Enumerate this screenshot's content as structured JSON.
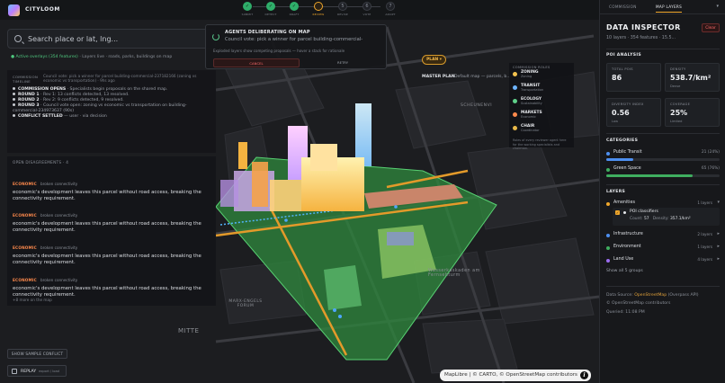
{
  "app": {
    "name": "CITYLOOM"
  },
  "steps": [
    {
      "num": "✓",
      "label": "SUBMIT",
      "state": "done"
    },
    {
      "num": "✓",
      "label": "DETECT",
      "state": "done"
    },
    {
      "num": "✓",
      "label": "DRAFT",
      "state": "done"
    },
    {
      "num": "",
      "label": "REVIEW",
      "state": "active"
    },
    {
      "num": "5",
      "label": "REVISE",
      "state": "todo"
    },
    {
      "num": "6",
      "label": "VOTE",
      "state": "todo"
    },
    {
      "num": "7",
      "label": "ADOPT",
      "state": "todo"
    }
  ],
  "search": {
    "placeholder": "Search place or lat, lng..."
  },
  "layer_hint": {
    "status": "● Active overlays (354 features)",
    "text": "· Layers live · roads, parks, buildings on map"
  },
  "timeline": {
    "title": "COMMISSION TIMELINE",
    "entries": [
      {
        "head": "",
        "body": "Council vote: pick a winner for parcel building-commercial-237182166 (zoning vs economic vs transportation) · 9hs ago"
      },
      {
        "head": "COMMISSION OPENS",
        "body": "· Specialists begin proposals on the shared map."
      },
      {
        "head": "ROUND 1",
        "body": "· Rev 1: 13 conflicts detected, 13 resolved."
      },
      {
        "head": "ROUND 2",
        "body": "· Rev 2: 9 conflicts detected, 9 resolved."
      },
      {
        "head": "ROUND 3",
        "body": "· Council vote open: zoning vs economic vs transportation on building-commercial-234973637 (90s)"
      },
      {
        "head": "CONFLICT SETTLED",
        "body": "— user · via decision"
      }
    ]
  },
  "disagreements": {
    "title": "OPEN DISAGREEMENTS · 4",
    "items": [
      {
        "tag": "ECONOMIC",
        "kind": "broken connectivity",
        "text": "economic's development leaves this parcel without road access, breaking the connectivity requirement."
      },
      {
        "tag": "ECONOMIC",
        "kind": "broken connectivity",
        "text": "economic's development leaves this parcel without road access, breaking the connectivity requirement."
      },
      {
        "tag": "ECONOMIC",
        "kind": "broken connectivity",
        "text": "economic's development leaves this parcel without road access, breaking the connectivity requirement."
      },
      {
        "tag": "ECONOMIC",
        "kind": "broken connectivity",
        "text": "economic's development leaves this parcel without road access, breaking the connectivity requirement."
      }
    ],
    "more": "+8 more on the map"
  },
  "buttons": {
    "sample": "SHOW SAMPLE CONFLICT",
    "replay": "REPLAY",
    "replay_sub": "export / load"
  },
  "agents": {
    "title": "AGENTS DELIBERATING ON MAP",
    "subtitle": "Council vote: pick a winner for parcel building-commercial-",
    "note": "Exploded layers show competing proposals — hover a stack for rationale",
    "cancel": "CANCEL",
    "retry": "RETRY"
  },
  "plan": {
    "button": "PLAN",
    "label": "MASTER PLAN",
    "sub": "Default map — parcels, b..."
  },
  "roles": {
    "title": "COMMISSION ROLES",
    "items": [
      {
        "name": "ZONING",
        "sub": "Zoning",
        "color": "#f2c14e"
      },
      {
        "name": "TRANSIT",
        "sub": "Transportation",
        "color": "#6db4ff"
      },
      {
        "name": "ECOLOGY",
        "sub": "Sustainability",
        "color": "#5fd08a"
      },
      {
        "name": "MARKETS",
        "sub": "Economic",
        "color": "#ff8a4c"
      },
      {
        "name": "CHAIR",
        "sub": "Coordinator",
        "color": "#e9b949"
      }
    ],
    "note": "Roles of every reviewer agent here for the working specialists and chairman."
  },
  "map_labels": {
    "street": "SCHEUNENVI",
    "forum": "MARX-ENGELS FORUM",
    "mitte": "MITTE",
    "fernsehturm": "Wasserkaskaden am Fernsehturm"
  },
  "attribution": {
    "text": "MapLibre | © CARTO, © OpenStreetMap contributors"
  },
  "panel": {
    "tabs": {
      "commission": "COMMISSION",
      "layers": "MAP LAYERS"
    },
    "title": "DATA INSPECTOR",
    "clear": "Clear",
    "subtitle": "10 layers · 354 features · 15.5...",
    "poi_heading": "POI ANALYSIS",
    "stats": [
      {
        "key": "TOTAL POIS",
        "value": "86",
        "unit": ""
      },
      {
        "key": "DENSITY",
        "value": "538.7/km²",
        "unit": "Dense"
      },
      {
        "key": "DIVERSITY INDEX",
        "value": "0.56",
        "unit": "Low"
      },
      {
        "key": "COVERAGE",
        "value": "25%",
        "unit": "Limited"
      }
    ],
    "categories_heading": "CATEGORIES",
    "categories": [
      {
        "name": "Public Transit",
        "count": "21 (24%)",
        "pct": 24,
        "color": "#4d8ff0"
      },
      {
        "name": "Green Space",
        "count": "65 (76%)",
        "pct": 76,
        "color": "#3fae5f"
      }
    ],
    "layers_heading": "LAYERS",
    "layers": [
      {
        "name": "Amenities",
        "count": "1 layers",
        "color": "#f0a72c",
        "chev": "▾"
      },
      {
        "name": "Infrastructure",
        "count": "2 layers",
        "color": "#4d8ff0",
        "chev": "▸"
      },
      {
        "name": "Environment",
        "count": "1 layers",
        "color": "#3fae5f",
        "chev": "▸"
      },
      {
        "name": "Land Use",
        "count": "4 layers",
        "color": "#9b6cf0",
        "chev": "▸"
      }
    ],
    "poi_layer": {
      "name": "POI classifiers",
      "count_label": "Count:",
      "count": "57",
      "density_label": "Density:",
      "density": "357.1/km²"
    },
    "show_all": "Show all 5 groups",
    "data_source_label": "Data Source:",
    "data_source": "OpenStreetMap",
    "data_source_api": "(Overpass API)",
    "copyright": "© OpenStreetMap contributors",
    "queried": "Queried: 11:08 PM"
  }
}
